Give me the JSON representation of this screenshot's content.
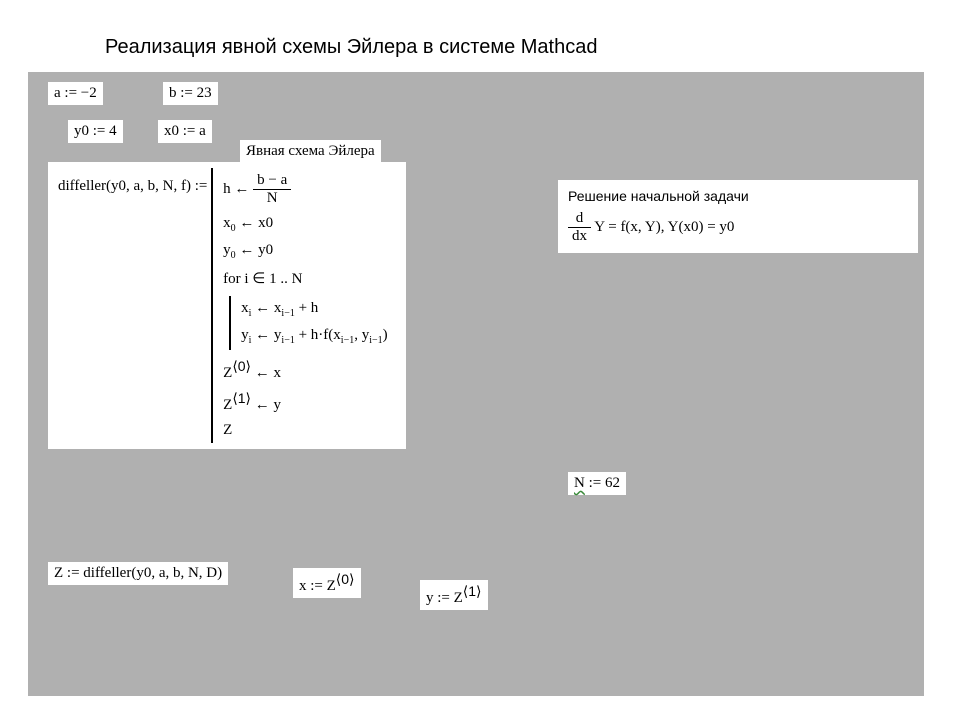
{
  "title": "Реализация явной схемы Эйлера в системе Mathcad",
  "assign": {
    "a": "a := −2",
    "b": "b := 23",
    "y0": "y0 := 4",
    "x0": "x0 := a",
    "N_label": "N",
    "N_assign": " := 62",
    "Z": "Z := diffeller(y0, a, b, N, D)",
    "xres_lhs": "x := Z",
    "xres_sup": "⟨0⟩",
    "yres_lhs": "y := Z",
    "yres_sup": "⟨1⟩"
  },
  "labels": {
    "scheme": "Явная схема Эйлера",
    "ivp_title": "Решение начальной задачи"
  },
  "ivp": {
    "frac_num": "d",
    "frac_den": "dx",
    "after_frac": " Y  =  f(x, Y),     Y(x0)  =  y0"
  },
  "func": {
    "lhs": "diffeller(y0, a, b, N, f)  := ",
    "h_lhs": "h ←",
    "h_num": "b − a",
    "h_den": "N",
    "x0line": "x",
    "x0sub": "0",
    "x0rhs": " ← x0",
    "y0line": "y",
    "y0sub": "0",
    "y0rhs": " ← y0",
    "forline": "for   i ∈ 1 .. N",
    "xi_l": "x",
    "xi_sub": "i",
    "xi_m": " ← x",
    "xi_sub2": "i−1",
    "xi_r": " + h",
    "yi_l": "y",
    "yi_sub": "i",
    "yi_m": " ← y",
    "yi_sub2": "i−1",
    "yi_r": " + h·f(x",
    "yi_arg1sub": "i−1",
    "yi_comma": ", y",
    "yi_arg2sub": "i−1",
    "yi_close": ")",
    "z0_l": "Z",
    "z0_sup": "⟨0⟩",
    "z0_r": " ← x",
    "z1_l": "Z",
    "z1_sup": "⟨1⟩",
    "z1_r": " ← y",
    "zret": "Z"
  }
}
